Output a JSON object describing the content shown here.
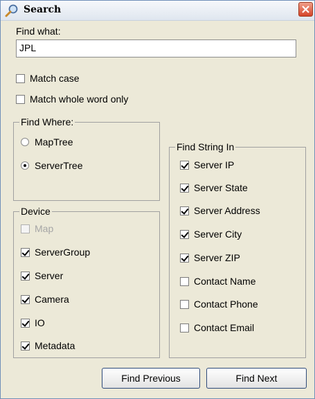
{
  "window": {
    "title": "Search",
    "title_icon": "search-icon",
    "close_icon": "close-icon"
  },
  "find_what": {
    "label": "Find what:",
    "value": "JPL"
  },
  "options": [
    {
      "label": "Match case",
      "checked": false
    },
    {
      "label": "Match whole word only",
      "checked": false
    }
  ],
  "find_where": {
    "legend": "Find Where:",
    "items": [
      {
        "label": "MapTree",
        "selected": false
      },
      {
        "label": "ServerTree",
        "selected": true
      }
    ]
  },
  "device": {
    "legend": "Device",
    "items": [
      {
        "label": "Map",
        "checked": false,
        "disabled": true
      },
      {
        "label": "ServerGroup",
        "checked": true
      },
      {
        "label": "Server",
        "checked": true
      },
      {
        "label": "Camera",
        "checked": true
      },
      {
        "label": "IO",
        "checked": true
      },
      {
        "label": "Metadata",
        "checked": true
      }
    ]
  },
  "find_string_in": {
    "legend": "Find String In",
    "items": [
      {
        "label": "Server IP",
        "checked": true
      },
      {
        "label": "Server State",
        "checked": true
      },
      {
        "label": "Server Address",
        "checked": true
      },
      {
        "label": "Server City",
        "checked": true
      },
      {
        "label": "Server ZIP",
        "checked": true
      },
      {
        "label": "Contact Name",
        "checked": false
      },
      {
        "label": "Contact Phone",
        "checked": false
      },
      {
        "label": "Contact Email",
        "checked": false
      }
    ]
  },
  "buttons": {
    "find_previous": "Find Previous",
    "find_next": "Find Next"
  },
  "colors": {
    "dialog_bg": "#ece9d8",
    "close_button": "#d5452a"
  }
}
